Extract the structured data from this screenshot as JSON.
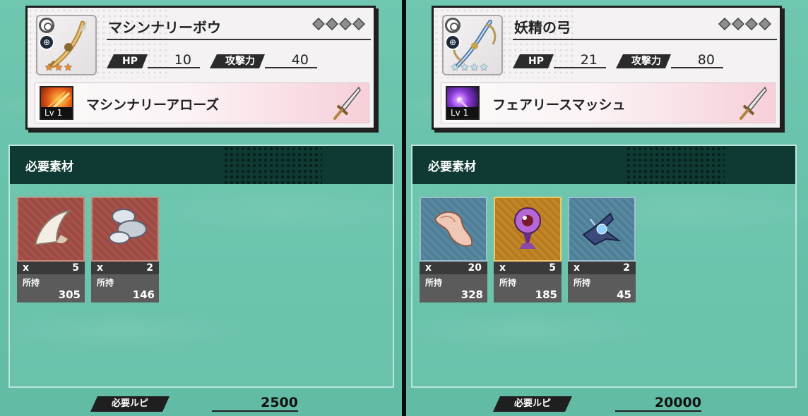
{
  "panels": [
    {
      "weapon_name": "マシンナリーボウ",
      "stars": {
        "count": 3,
        "color": "#f28a2a"
      },
      "gems": 4,
      "hp_label": "HP",
      "hp_value": "10",
      "atk_label": "攻撃力",
      "atk_value": "40",
      "skill": {
        "level_label": "Lv 1",
        "name": "マシンナリーアローズ",
        "icon": "fire-arrow-icon"
      },
      "materials_title": "必要素材",
      "materials": [
        {
          "icon": "claw-icon",
          "qty_prefix": "x",
          "qty": "5",
          "own_label": "所持",
          "own": "305",
          "frame": "red"
        },
        {
          "icon": "stones-icon",
          "qty_prefix": "x",
          "qty": "2",
          "own_label": "所持",
          "own": "146",
          "frame": "red"
        }
      ],
      "rupee_label": "必要ルピ",
      "rupee_value": "2500"
    },
    {
      "weapon_name": "妖精の弓",
      "stars": {
        "count": 4,
        "color": "#bfe6f6"
      },
      "gems": 4,
      "hp_label": "HP",
      "hp_value": "21",
      "atk_label": "攻撃力",
      "atk_value": "80",
      "skill": {
        "level_label": "Lv 1",
        "name": "フェアリースマッシュ",
        "icon": "purple-orb-icon"
      },
      "materials_title": "必要素材",
      "materials": [
        {
          "icon": "shell-icon",
          "qty_prefix": "x",
          "qty": "20",
          "own_label": "所持",
          "own": "328",
          "frame": "blue"
        },
        {
          "icon": "eye-orb-icon",
          "qty_prefix": "x",
          "qty": "5",
          "own_label": "所持",
          "own": "185",
          "frame": "gold"
        },
        {
          "icon": "crystal-icon",
          "qty_prefix": "x",
          "qty": "2",
          "own_label": "所持",
          "own": "45",
          "frame": "blue"
        }
      ],
      "rupee_label": "必要ルピ",
      "rupee_value": "20000"
    }
  ]
}
